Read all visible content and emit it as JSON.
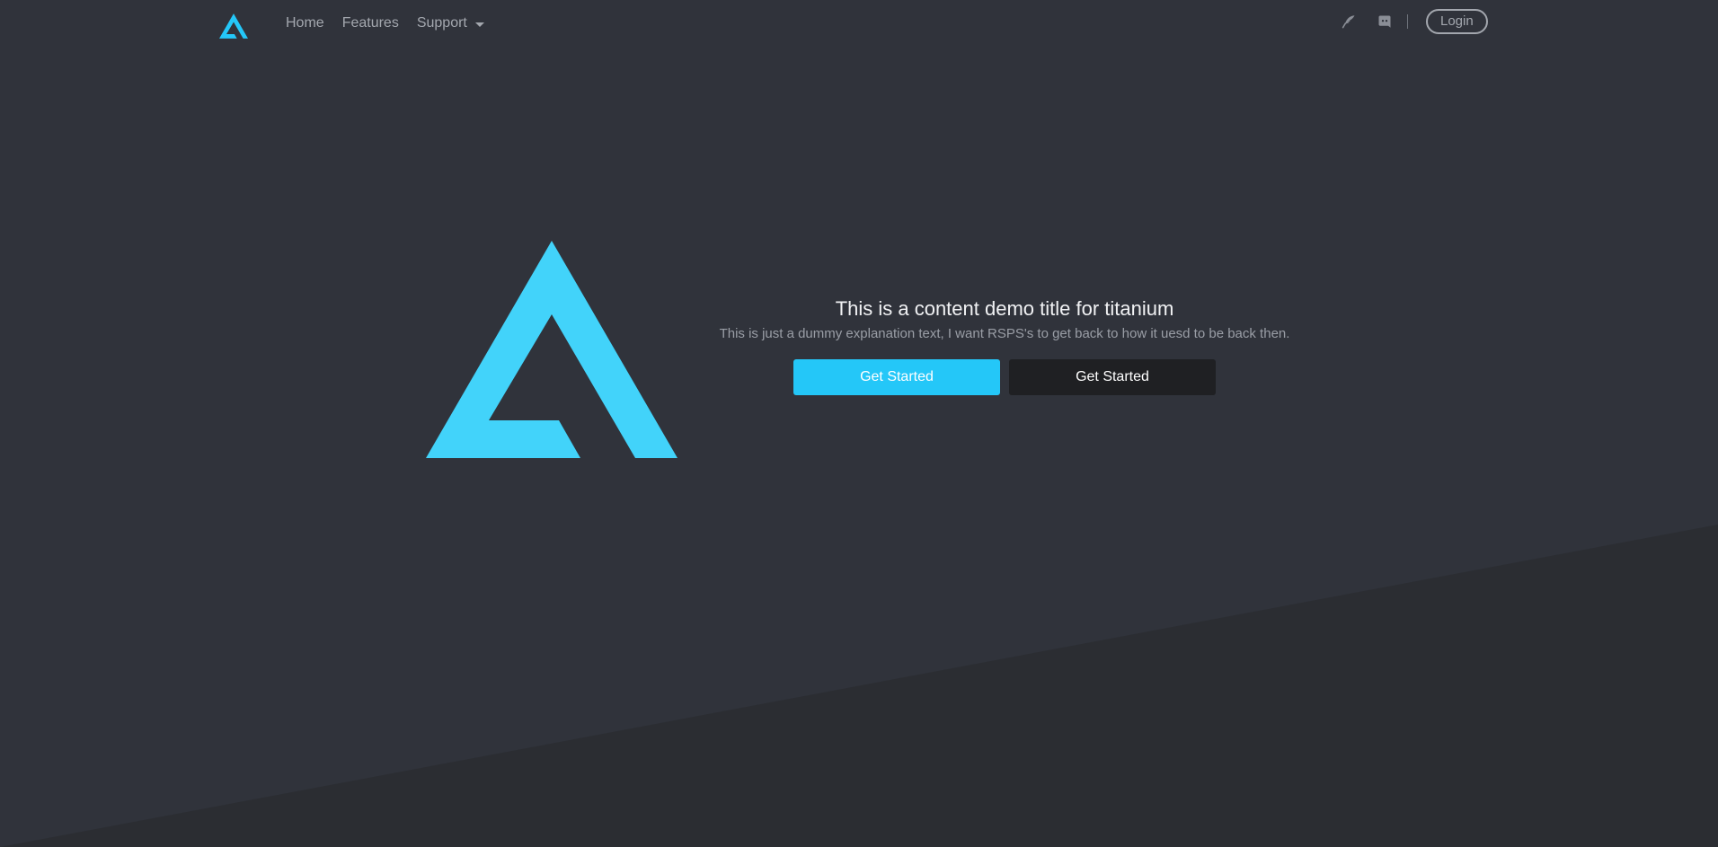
{
  "colors": {
    "accent": "#24c7f8",
    "background": "#30333b",
    "background_dark": "#2b2d32",
    "nav_text": "#a3a7ae",
    "button_dark": "#1f2023"
  },
  "navbar": {
    "logo_icon": "titanium-logo-icon",
    "links": [
      {
        "label": "Home"
      },
      {
        "label": "Features"
      },
      {
        "label": "Support",
        "dropdown": true
      }
    ],
    "icons": [
      "feather-icon",
      "discord-icon"
    ],
    "login_label": "Login"
  },
  "hero": {
    "logo_icon": "titanium-logo-icon",
    "title": "This is a content demo title for titanium",
    "subtitle": "This is just a dummy explanation text, I want RSPS's to get back to how it uesd to be back then.",
    "primary_button": "Get Started",
    "secondary_button": "Get Started"
  }
}
